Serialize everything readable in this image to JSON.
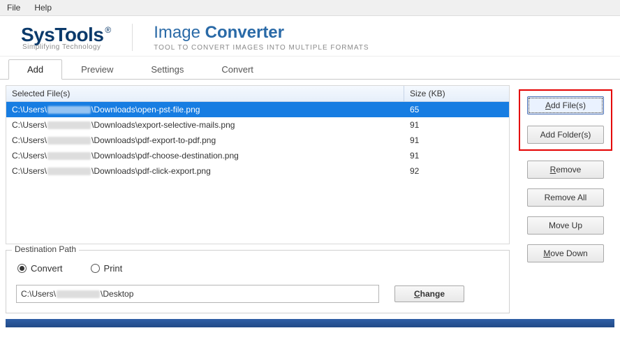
{
  "menu": {
    "file": "File",
    "help": "Help"
  },
  "brand": {
    "name": "SysTools",
    "reg": "®",
    "tagline": "Simplifying Technology",
    "title_light": "Image",
    "title_bold": "Converter",
    "subtitle": "TOOL TO CONVERT IMAGES INTO MULTIPLE FORMATS"
  },
  "tabs": {
    "add": "Add",
    "preview": "Preview",
    "settings": "Settings",
    "convert": "Convert"
  },
  "table": {
    "h_file": "Selected File(s)",
    "h_size": "Size (KB)",
    "rows": [
      {
        "prefix": "C:\\Users\\",
        "suffix": "\\Downloads\\open-pst-file.png",
        "size": "65",
        "selected": true
      },
      {
        "prefix": "C:\\Users\\",
        "suffix": "\\Downloads\\export-selective-mails.png",
        "size": "91",
        "selected": false
      },
      {
        "prefix": "C:\\Users\\",
        "suffix": "\\Downloads\\pdf-export-to-pdf.png",
        "size": "91",
        "selected": false
      },
      {
        "prefix": "C:\\Users\\",
        "suffix": "\\Downloads\\pdf-choose-destination.png",
        "size": "91",
        "selected": false
      },
      {
        "prefix": "C:\\Users\\",
        "suffix": "\\Downloads\\pdf-click-export.png",
        "size": "92",
        "selected": false
      }
    ]
  },
  "dest": {
    "legend": "Destination Path",
    "convert": "Convert",
    "print": "Print",
    "path_prefix": "C:\\Users\\",
    "path_suffix": "\\Desktop",
    "change_pre": "C",
    "change_rest": "hange"
  },
  "buttons": {
    "addfile_pre": "A",
    "addfile_rest": "dd File(s)",
    "addfolder": "Add Folder(s)",
    "remove_pre": "R",
    "remove_rest": "emove",
    "removeall": "Remove All",
    "moveup": "Move Up",
    "movedown_pre": "M",
    "movedown_rest": "ove Down"
  }
}
